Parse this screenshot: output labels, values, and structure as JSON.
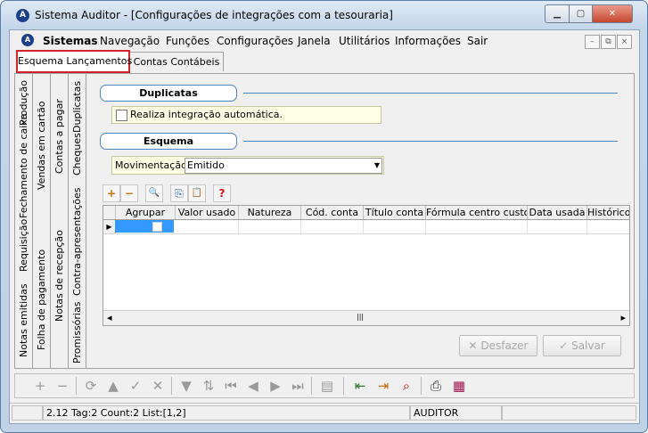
{
  "window": {
    "title": "Sistema Auditor - [Configurações de integrações com a tesouraria]",
    "app_icon": "A",
    "min_glyph": "▁",
    "max_glyph": "▢",
    "close_glyph": "✕"
  },
  "menu": {
    "logo": "A",
    "items": [
      "Sistemas",
      "Navegação",
      "Funções",
      "Configurações",
      "Janela",
      "Utilitários",
      "Informações",
      "Sair"
    ],
    "mdi_controls": [
      "–",
      "⧉",
      "×"
    ]
  },
  "tabs": [
    "Esquema Lançamentos",
    "Contas Contábeis"
  ],
  "vertical_tabs": {
    "col1": [
      "Notas emitidas",
      "Requisição",
      "Fechamento de caixa",
      "Produção"
    ],
    "col2": [
      "Folha de pagamento",
      "Vendas em cartão"
    ],
    "col3": [
      "Notas de recepção",
      "Contas a pagar"
    ],
    "col4": [
      "Promissórias",
      "Contra-apresentações",
      "Cheques",
      "Duplicatas"
    ]
  },
  "sections": {
    "duplicatas": "Duplicatas",
    "esquema": "Esquema"
  },
  "checkbox": {
    "label": "Realiza integração automática.",
    "checked": false
  },
  "movimentacao": {
    "label": "Movimentação:",
    "value": "Emitido"
  },
  "grid_toolbar": {
    "icons": [
      "add-icon",
      "remove-icon",
      "search-icon",
      "copy-icon",
      "paste-icon",
      "help-icon"
    ],
    "glyphs": [
      "+",
      "−",
      "🔍",
      "⎘",
      "📋",
      "?"
    ]
  },
  "grid": {
    "columns": [
      "Agrupar",
      "Valor usado",
      "Natureza",
      "Cód. conta",
      "Título conta",
      "Fórmula centro custo",
      "Data usada",
      "Histórico"
    ],
    "row_indicator": "▶",
    "scroll_left": "◂",
    "scroll_right": "▸",
    "scroll_grip": "|||"
  },
  "actions": {
    "undo": "Desfazer",
    "save": "Salvar"
  },
  "navbar": {
    "icons": [
      "add-icon",
      "remove-icon",
      "refresh-icon",
      "up-icon",
      "confirm-icon",
      "cancel-icon",
      "filter-icon",
      "sort-icon",
      "first-icon",
      "prev-icon",
      "next-icon",
      "last-icon",
      "print-preview-icon",
      "export-icon",
      "import-icon",
      "search-record-icon",
      "printer-icon",
      "report-icon"
    ],
    "glyphs": [
      "+",
      "−",
      "⟳",
      "▲",
      "✓",
      "✕",
      "▼",
      "⇅",
      "⏮",
      "◀",
      "▶",
      "⏭",
      "▤",
      "⇤",
      "⇥",
      "⌕",
      "⎙",
      "▦"
    ]
  },
  "status": {
    "info": "2.12 Tag:2 Count:2 List:[1,2]",
    "user": "AUDITOR"
  }
}
